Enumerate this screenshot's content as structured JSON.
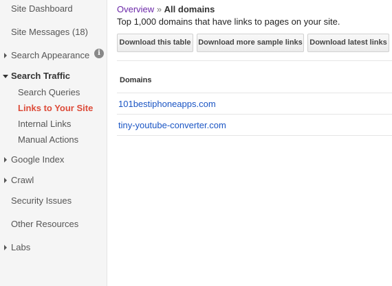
{
  "sidebar": {
    "items": [
      {
        "label": "Site Dashboard"
      },
      {
        "label": "Site Messages (18)"
      },
      {
        "label": "Search Appearance"
      },
      {
        "label": "Search Traffic"
      },
      {
        "label": "Google Index"
      },
      {
        "label": "Crawl"
      },
      {
        "label": "Security Issues"
      },
      {
        "label": "Other Resources"
      },
      {
        "label": "Labs"
      }
    ],
    "search_traffic_sub": [
      {
        "label": "Search Queries"
      },
      {
        "label": "Links to Your Site",
        "active": true
      },
      {
        "label": "Internal Links"
      },
      {
        "label": "Manual Actions"
      }
    ],
    "info_icon_glyph": "i"
  },
  "breadcrumb": {
    "link": "Overview",
    "separator": "»",
    "current": "All domains"
  },
  "subtitle": "Top 1,000 domains that have links to pages on your site.",
  "buttons": {
    "download_table": "Download this table",
    "download_sample": "Download more sample links",
    "download_latest": "Download latest links"
  },
  "table": {
    "header": "Domains",
    "rows": [
      "101bestiphoneapps.com",
      "tiny-youtube-converter.com"
    ]
  },
  "colors": {
    "active_nav": "#dd4b39",
    "link": "#1a55c4",
    "visited_link": "#6b27a8"
  }
}
